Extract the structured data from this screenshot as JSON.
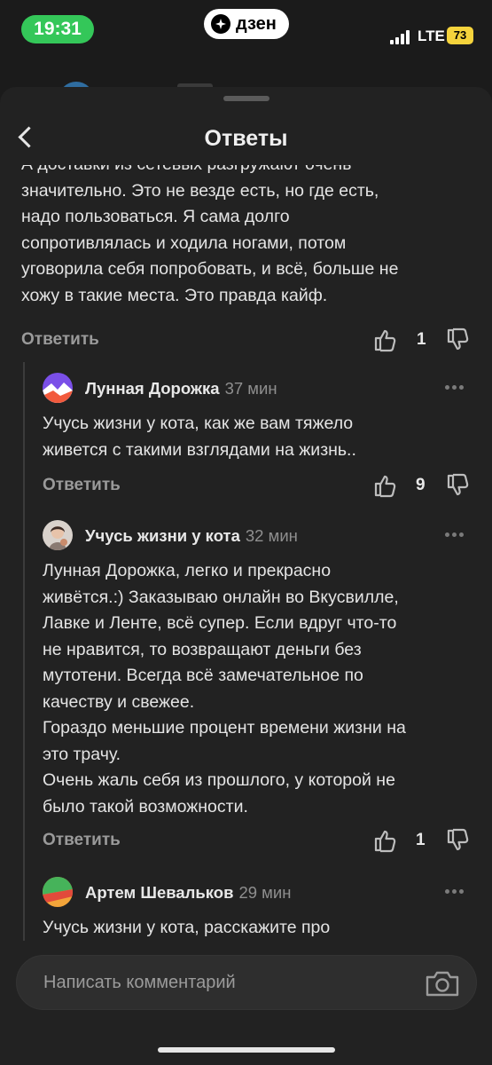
{
  "status_bar": {
    "time": "19:31",
    "app_badge": "дзен",
    "network": "LTE",
    "battery": "73",
    "time_pill_color": "#34c759",
    "battery_color": "#f5d33c"
  },
  "sheet": {
    "title": "Ответы"
  },
  "parent_comment": {
    "text_lines": [
      "А доставки из сетевых разгружают очень",
      "значительно. Это не везде есть, но где есть,",
      "надо пользоваться. Я сама долго",
      "сопротивлялась и ходила ногами, потом",
      "уговорила себя попробовать, и всё, больше не",
      "хожу в такие места. Это правда кайф."
    ],
    "reply_label": "Ответить",
    "likes": "1"
  },
  "replies": [
    {
      "author": "Лунная Дорожка",
      "time_ago": "37 мин",
      "text_lines": [
        "Учусь жизни у кота, как же вам тяжело",
        "живется с такими взглядами на жизнь.."
      ],
      "reply_label": "Ответить",
      "likes": "9"
    },
    {
      "author": "Учусь жизни у кота",
      "time_ago": "32 мин",
      "text_lines": [
        "Лунная Дорожка, легко и прекрасно",
        "живётся.:) Заказываю онлайн во Вкусвилле,",
        "Лавке и Ленте, всё супер. Если вдруг что-то",
        "не нравится, то возвращают деньги без",
        "мутотени. Всегда всё замечательное по",
        "качеству и свежее.",
        "Гораздо меньшие процент времени жизни на",
        "это трачу.",
        "Очень жаль себя из прошлого, у которой не",
        "было такой возможности."
      ],
      "reply_label": "Ответить",
      "likes": "1"
    },
    {
      "author": "Артем Шевальков",
      "time_ago": "29 мин",
      "text_lines": [
        "Учусь жизни у кота, расскажите про"
      ]
    }
  ],
  "composer": {
    "placeholder": "Написать комментарий"
  },
  "icons": [
    "back-icon",
    "like-icon",
    "dislike-icon",
    "more-icon",
    "camera-icon",
    "zen-logo-icon",
    "signal-icon"
  ]
}
